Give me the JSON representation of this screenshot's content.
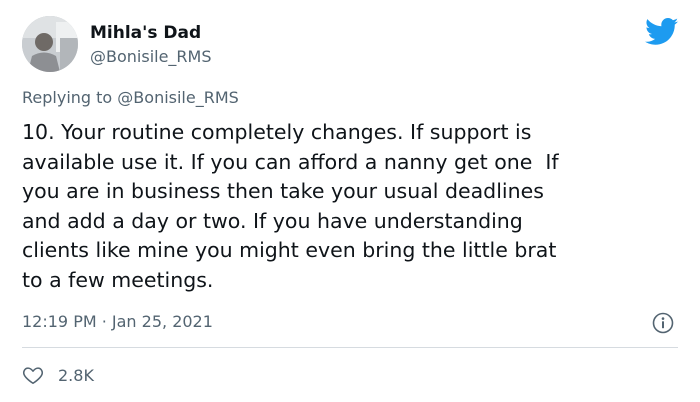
{
  "author": {
    "display_name": "Mihla's Dad",
    "handle": "@Bonisile_RMS"
  },
  "reply": {
    "prefix": "Replying to ",
    "to_handle": "@Bonisile_RMS"
  },
  "tweet": {
    "lines": [
      "10. Your routine completely changes. If support is",
      "available use it. If you can afford a nanny get one  If",
      "you are in business then take your usual deadlines",
      "and add a day or two. If you have understanding",
      "clients like mine you might even bring the little brat",
      "to a few meetings."
    ]
  },
  "meta": {
    "timestamp": "12:19 PM · Jan 25, 2021"
  },
  "engagement": {
    "likes": "2.8K"
  },
  "icons": {
    "brand": "twitter-bird-icon",
    "info": "info-icon",
    "like": "heart-icon"
  },
  "colors": {
    "brand_blue": "#1d9bf0",
    "text_primary": "#0f1419",
    "text_secondary": "#536471",
    "divider": "#d6dbe0"
  }
}
